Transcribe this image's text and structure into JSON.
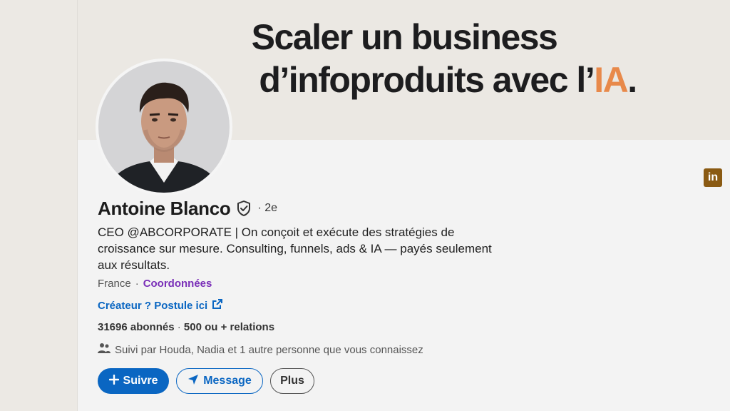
{
  "banner": {
    "line1": "Scaler un business",
    "line2_prefix": "d’infoproduits avec l’",
    "line2_accent": "IA",
    "line2_suffix": ".",
    "accent_color": "#e8894a"
  },
  "profile": {
    "name": "Antoine Blanco",
    "degree": "· 2e",
    "headline": "CEO @ABCORPORATE | On conçoit et exécute des stratégies de croissance sur mesure. Consulting, funnels, ads & IA — payés seulement aux résultats.",
    "location": "France",
    "contact_separator": "·",
    "contact_label": "Coordonnées",
    "creator_link": "Créateur ? Postule ici",
    "followers": "31696 abonnés",
    "stats_separator": "·",
    "connections": "500 ou + relations",
    "mutual": "Suivi par Houda, Nadia et 1 autre personne que vous connaissez"
  },
  "actions": {
    "follow_label": "Suivre",
    "message_label": "Message",
    "more_label": "Plus"
  },
  "icons": {
    "verified": "shield-check-icon",
    "external": "external-link-icon",
    "people": "people-icon",
    "plus": "plus-icon",
    "send": "paper-plane-icon",
    "linkedin": "linkedin-logo-icon"
  },
  "linkedin_badge": {
    "text": "in",
    "color": "#8a5a12"
  },
  "colors": {
    "primary": "#0a66c2",
    "contact": "#7a2fb8"
  }
}
